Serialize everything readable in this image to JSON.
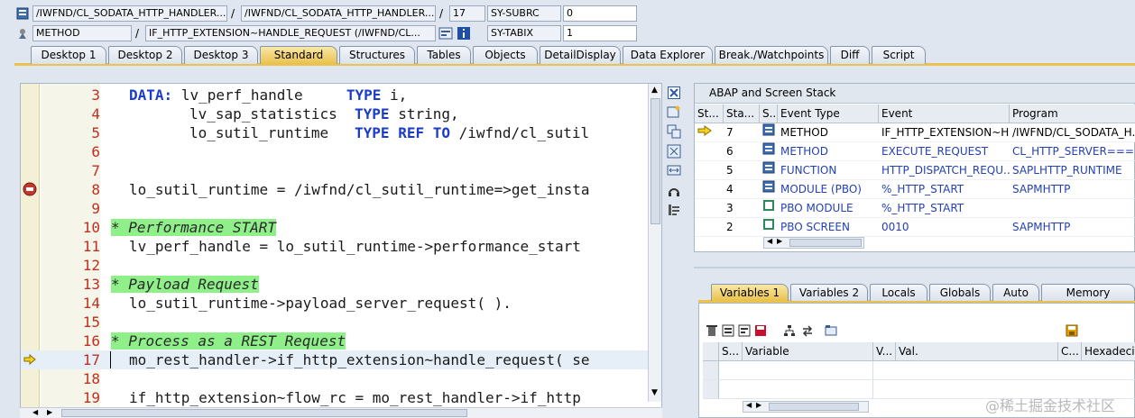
{
  "header": {
    "row1": {
      "program1": "/IWFND/CL_SODATA_HTTP_HANDLER...",
      "sep1": "/",
      "program2": "/IWFND/CL_SODATA_HTTP_HANDLER...",
      "sep2": "/",
      "line": "17",
      "sys_field": "SY-SUBRC",
      "sys_value": "0"
    },
    "row2": {
      "kind": "METHOD",
      "sep": "/",
      "method": "IF_HTTP_EXTENSION~HANDLE_REQUEST (/IWFND/CL...",
      "sys_field": "SY-TABIX",
      "sys_value": "1"
    }
  },
  "tabs": [
    "Desktop 1",
    "Desktop 2",
    "Desktop 3",
    "Standard",
    "Structures",
    "Tables",
    "Objects",
    "DetailDisplay",
    "Data Explorer",
    "Break./Watchpoints",
    "Diff",
    "Script"
  ],
  "active_tab": "Standard",
  "code_lines": [
    {
      "n": "3",
      "text": ""
    },
    {
      "n": "4",
      "text": ""
    },
    {
      "n": "5",
      "text": ""
    },
    {
      "n": "6",
      "text": ""
    },
    {
      "n": "7",
      "text": ""
    },
    {
      "n": "8",
      "text": "lo_sutil_runtime = /iwfnd/cl_sutil_runtime=>get_insta"
    },
    {
      "n": "9",
      "text": ""
    },
    {
      "n": "10",
      "text": "* Performance START"
    },
    {
      "n": "11",
      "text": "lv_perf_handle = lo_sutil_runtime->performance_start"
    },
    {
      "n": "12",
      "text": ""
    },
    {
      "n": "13",
      "text": "* Payload Request"
    },
    {
      "n": "14",
      "text": "lo_sutil_runtime->payload_server_request( )."
    },
    {
      "n": "15",
      "text": ""
    },
    {
      "n": "16",
      "text": "* Process as a REST Request"
    },
    {
      "n": "17",
      "text": "mo_rest_handler->if_http_extension~handle_request( se"
    },
    {
      "n": "18",
      "text": ""
    },
    {
      "n": "19",
      "text": "if_http_extension~flow_rc = mo_rest_handler->if_http"
    }
  ],
  "code_decl": {
    "l3_kw": "DATA:",
    "l3_var": "lv_perf_handle",
    "l3_type": "TYPE",
    "l3_val": "i,",
    "l4_var": "lv_sap_statistics",
    "l4_type": "TYPE",
    "l4_val": "string,",
    "l5_var": "lo_sutil_runtime",
    "l5_type": "TYPE",
    "l5_ref": "REF",
    "l5_to": "TO",
    "l5_val": "/iwfnd/cl_sutil"
  },
  "stack": {
    "title": "ABAP and Screen Stack",
    "columns": [
      "St...",
      "Sta...",
      "S..",
      "Event Type",
      "Event",
      "Program"
    ],
    "rows": [
      {
        "current": true,
        "level": "7",
        "type": "METHOD",
        "event": "IF_HTTP_EXTENSION~H...",
        "program": "/IWFND/CL_SODATA_H..."
      },
      {
        "current": false,
        "level": "6",
        "type": "METHOD",
        "event": "EXECUTE_REQUEST",
        "program": "CL_HTTP_SERVER====..."
      },
      {
        "current": false,
        "level": "5",
        "type": "FUNCTION",
        "event": "HTTP_DISPATCH_REQU...",
        "program": "SAPLHTTP_RUNTIME"
      },
      {
        "current": false,
        "level": "4",
        "type": "MODULE (PBO)",
        "event": "%_HTTP_START",
        "program": "SAPMHTTP"
      },
      {
        "current": false,
        "level": "3",
        "type": "PBO MODULE",
        "event": "%_HTTP_START",
        "program": ""
      },
      {
        "current": false,
        "level": "2",
        "type": "PBO SCREEN",
        "event": "0010",
        "program": "SAPMHTTP"
      }
    ]
  },
  "var_tabs": [
    "Variables 1",
    "Variables 2",
    "Locals",
    "Globals",
    "Auto",
    "Memory Analysis"
  ],
  "var_table": {
    "columns": [
      "S...",
      "Variable",
      "V...",
      "Val.",
      "C...",
      "Hexadecimal"
    ]
  },
  "watermark": "@稀土掘金技术社区",
  "colors": {
    "active_tab": "#eac24d",
    "comment_bg": "#8ff08a",
    "keyword": "#1a3cc8",
    "line_number": "#c03020"
  }
}
